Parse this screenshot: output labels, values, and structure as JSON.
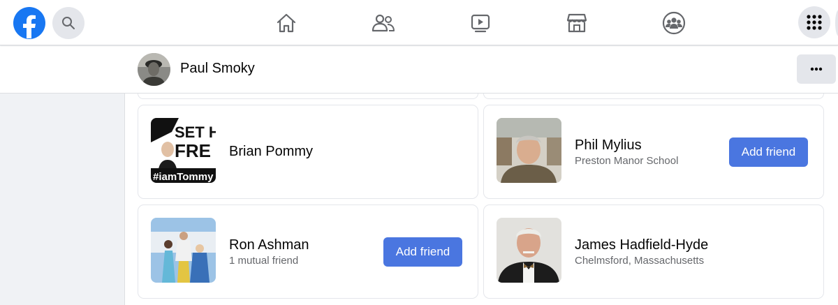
{
  "nav": {
    "logo": "facebook-logo",
    "icons": [
      "home-icon",
      "friends-icon",
      "watch-icon",
      "marketplace-icon",
      "groups-icon"
    ],
    "menu_icon": "grid-menu-icon",
    "accent": "#1877f2"
  },
  "profile": {
    "name": "Paul Smoky",
    "more_label": "..."
  },
  "friends": [
    {
      "name": "Brian Pommy",
      "subtitle": "",
      "action": "",
      "thumb_text_1": "SET H",
      "thumb_text_2": "FRE",
      "thumb_text_3": "#iamTommy"
    },
    {
      "name": "Phil Mylius",
      "subtitle": "Preston Manor School",
      "action": "Add friend"
    },
    {
      "name": "Ron Ashman",
      "subtitle": "1 mutual friend",
      "action": "Add friend"
    },
    {
      "name": "James Hadfield-Hyde",
      "subtitle": "Chelmsford, Massachusetts",
      "action": ""
    }
  ],
  "colors": {
    "button": "#4a76e0",
    "background": "#f0f2f5"
  }
}
